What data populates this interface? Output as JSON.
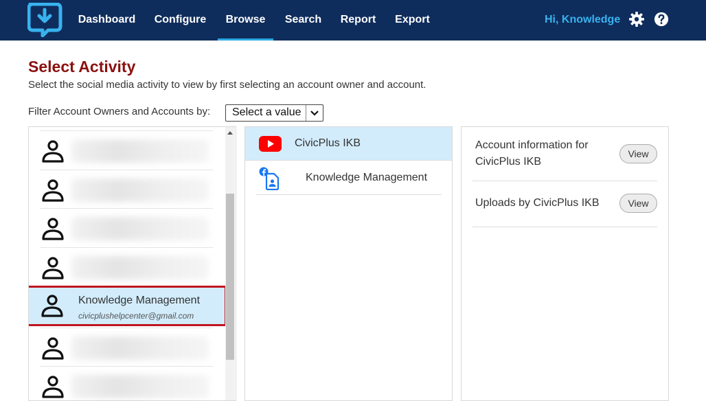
{
  "nav": {
    "items": [
      {
        "label": "Dashboard",
        "active": false
      },
      {
        "label": "Configure",
        "active": false
      },
      {
        "label": "Browse",
        "active": true
      },
      {
        "label": "Search",
        "active": false
      },
      {
        "label": "Report",
        "active": false
      },
      {
        "label": "Export",
        "active": false
      }
    ],
    "greeting": "Hi, Knowledge"
  },
  "page": {
    "title": "Select Activity",
    "description": "Select the social media activity to view by first selecting an account owner and account."
  },
  "filter": {
    "label": "Filter Account Owners and Accounts by:",
    "selected": "Select a value"
  },
  "owners": {
    "selected": {
      "name": "Knowledge Management",
      "email": "civicplushelpcenter@gmail.com"
    }
  },
  "accounts": [
    {
      "label": "CivicPlus IKB",
      "icon": "youtube-icon",
      "selected": true
    },
    {
      "label": "Knowledge Management",
      "icon": "facebook-profile-icon",
      "selected": false
    }
  ],
  "activities": [
    {
      "line1": "Account information for",
      "line2": "CivicPlus IKB",
      "button": "View"
    },
    {
      "line1": "Uploads by CivicPlus IKB",
      "button": "View"
    }
  ],
  "colors": {
    "nav_bg": "#0f2d5c",
    "accent": "#2aa8e0",
    "title": "#8b1010",
    "selection_bg": "#d2ecfb",
    "highlight_border": "#c0151f"
  }
}
